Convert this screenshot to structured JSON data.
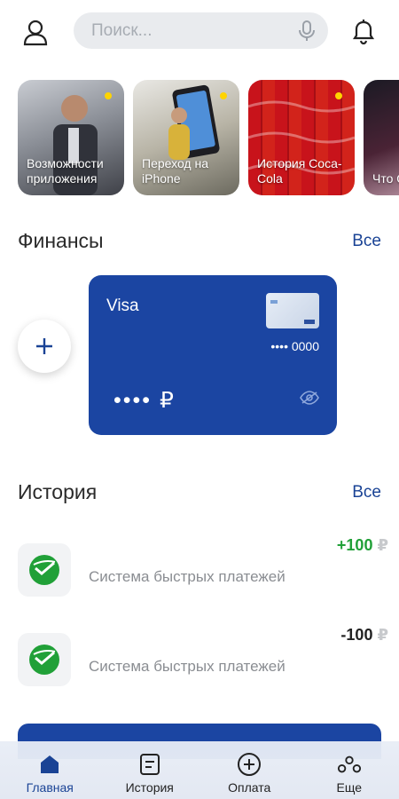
{
  "search": {
    "placeholder": "Поиск..."
  },
  "stories": [
    {
      "label": "Возможности приложения"
    },
    {
      "label": "Переход на iPhone"
    },
    {
      "label": "История Coca-Cola"
    },
    {
      "label": "Что QR-к"
    }
  ],
  "finances": {
    "title": "Финансы",
    "all_link": "Все",
    "card": {
      "brand": "Visa",
      "masked_number": "•••• 0000",
      "balance": "•••• ₽"
    }
  },
  "history": {
    "title": "История",
    "all_link": "Все",
    "transactions": [
      {
        "name": "Система быстрых платежей",
        "amount": "+100",
        "currency": "₽",
        "color": "#21a038"
      },
      {
        "name": "Система быстрых платежей",
        "amount": "-100",
        "currency": "₽",
        "color": "#222222"
      }
    ]
  },
  "tabbar": {
    "items": [
      {
        "label": "Главная",
        "icon": "home-icon",
        "active": true
      },
      {
        "label": "История",
        "icon": "history-icon",
        "active": false
      },
      {
        "label": "Оплата",
        "icon": "payment-plus-icon",
        "active": false
      },
      {
        "label": "Еще",
        "icon": "more-icon",
        "active": false
      }
    ]
  },
  "colors": {
    "accent": "#1a4395",
    "card": "#1b45a2",
    "positive": "#21a038",
    "sber_green": "#21a038"
  }
}
